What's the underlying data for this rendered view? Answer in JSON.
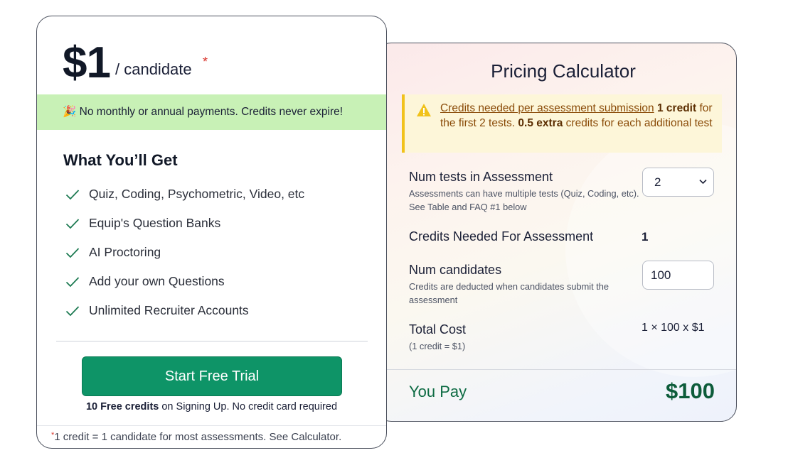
{
  "plan": {
    "price": "$1",
    "unit": "/ candidate",
    "asterisk": "*",
    "banner_emoji": "🎉",
    "banner_text": "No monthly or annual payments. Credits never expire!",
    "section_title": "What You’ll Get",
    "features": [
      "Quiz, Coding, Psychometric, Video, etc",
      "Equip's Question Banks",
      "AI Proctoring",
      "Add your own Questions",
      "Unlimited Recruiter Accounts"
    ],
    "cta_label": "Start Free Trial",
    "cta_note_bold": "10 Free credits",
    "cta_note_rest": " on Signing Up. No credit card required",
    "footnote_star": "*",
    "footnote_text": "1 credit = 1 candidate for most assessments. See Calculator."
  },
  "calculator": {
    "title": "Pricing Calculator",
    "warning": {
      "link": "Credits needed per assessment submission",
      "bold1": "1 credit",
      "text1": "for the first 2 tests.",
      "bold2": "0.5 extra",
      "text2": "credits for each additional test"
    },
    "num_tests": {
      "label": "Num tests in Assessment",
      "help": "Assessments can have multiple tests (Quiz, Coding, etc). See Table and FAQ #1 below",
      "value": "2"
    },
    "credits_needed": {
      "label": "Credits Needed For Assessment",
      "value": "1"
    },
    "num_candidates": {
      "label": "Num candidates",
      "help": "Credits are deducted when candidates submit the assessment",
      "value": "100"
    },
    "total_cost": {
      "label": "Total Cost",
      "help": "(1 credit = $1)",
      "formula": "1 × 100 x $1"
    },
    "you_pay_label": "You Pay",
    "you_pay_amount": "$100"
  },
  "colors": {
    "accent_green": "#0e9467",
    "banner_green": "#c8f1b6",
    "warning_yellow": "#f1c21b",
    "pay_green": "#0d5c3a",
    "check_green": "#1d7a52"
  },
  "icons": {
    "check": "check-icon",
    "warning": "warning-triangle-icon",
    "chevron": "chevron-down-icon",
    "party": "party-popper-icon"
  }
}
